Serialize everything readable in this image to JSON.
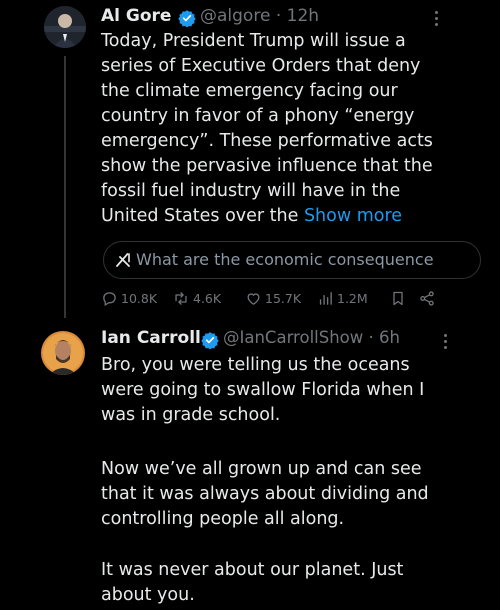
{
  "tweet1": {
    "name": "Al Gore",
    "handle": "@algore",
    "time": "12h",
    "lines": [
      "Today, President Trump will issue a",
      "series of Executive Orders that deny",
      "the climate emergency facing our",
      "country in favor of a phony “energy",
      "emergency”. These performative acts",
      "show the pervasive influence that the",
      "fossil fuel industry will have in the"
    ],
    "last_line": "United States over the",
    "show_more": "Show more",
    "grok_prompt": "What are the economic consequence",
    "stats": {
      "replies": "10.8K",
      "reposts": "4.6K",
      "likes": "15.7K",
      "views": "1.2M"
    }
  },
  "tweet2": {
    "name": "Ian Carroll",
    "handle": "@IanCarrollShow",
    "time": "6h",
    "lines": [
      "Bro, you were telling us the oceans",
      "were going to swallow Florida when I",
      "was in grade school.",
      "",
      "Now we’ve all grown up and can see",
      "that it was always about dividing and",
      "controlling people all along.",
      "",
      "It was never about our planet. Just",
      "about you."
    ]
  },
  "separator": "·",
  "colors": {
    "background": "#000000",
    "text": "#e7e9ea",
    "muted": "#71767b",
    "link": "#1d9bf0",
    "verified": "#1d9bf0"
  }
}
